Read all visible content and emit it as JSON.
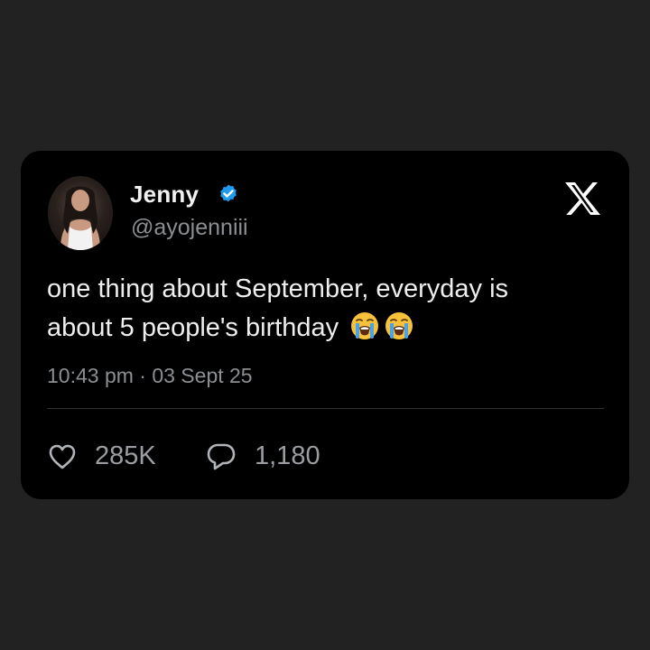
{
  "tweet": {
    "author": {
      "display_name": "Jenny",
      "handle": "@ayojenniii",
      "verified": true,
      "verified_color": "#1d9bf0"
    },
    "text_line1": "one thing about September, everyday is",
    "text_line2": "about 5 people's birthday",
    "emojis": [
      "loudly-crying-face",
      "loudly-crying-face"
    ],
    "timestamp": "10:43 pm · 03 Sept 25",
    "likes": "285K",
    "replies": "1,180"
  },
  "icons": {
    "logo": "x-logo-icon",
    "like": "heart-icon",
    "reply": "speech-bubble-icon",
    "badge": "verified-badge-icon"
  },
  "colors": {
    "page_background": "#222222",
    "card_background": "#000000",
    "text": "#eeeeee",
    "muted_text": "#8b8f93"
  }
}
